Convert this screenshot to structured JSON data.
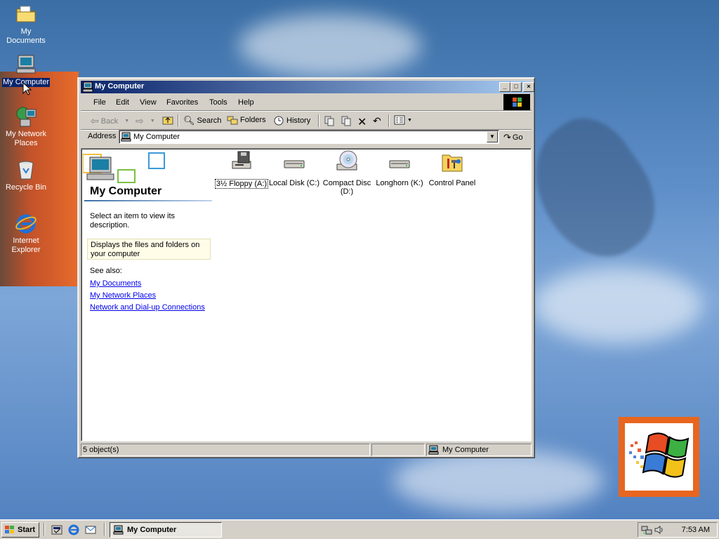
{
  "desktop": {
    "icons": [
      {
        "label": "My Documents"
      },
      {
        "label": "My Computer"
      },
      {
        "label": "My Network Places"
      },
      {
        "label": "Recycle Bin"
      },
      {
        "label": "Internet Explorer"
      }
    ]
  },
  "window": {
    "title": "My Computer",
    "buttons": {
      "minimize": "_",
      "maximize": "□",
      "close": "×"
    },
    "menu": [
      "File",
      "Edit",
      "View",
      "Favorites",
      "Tools",
      "Help"
    ],
    "toolbar": {
      "back": "Back",
      "search": "Search",
      "folders": "Folders",
      "history": "History"
    },
    "address": {
      "label": "Address",
      "value": "My Computer",
      "go": "Go"
    },
    "left_pane": {
      "title": "My Computer",
      "select_text": "Select an item to view its description.",
      "info_box": "Displays the files and folders on your computer",
      "see_also": "See also:",
      "links": [
        "My Documents",
        "My Network Places",
        "Network and Dial-up Connections"
      ]
    },
    "items": [
      {
        "label": "3½ Floppy (A:)",
        "icon": "floppy-drive-icon",
        "selected": true
      },
      {
        "label": "Local Disk (C:)",
        "icon": "hard-disk-icon"
      },
      {
        "label": "Compact Disc (D:)",
        "icon": "cd-drive-icon"
      },
      {
        "label": "Longhorn (K:)",
        "icon": "hard-disk-icon"
      },
      {
        "label": "Control Panel",
        "icon": "control-panel-icon"
      }
    ],
    "status": {
      "count": "5 object(s)",
      "location": "My Computer"
    }
  },
  "taskbar": {
    "start": "Start",
    "task": "My Computer",
    "clock": "7:53 AM"
  },
  "colors": {
    "titlebar_start": "#0a246a",
    "titlebar_end": "#a6caf0",
    "chrome": "#d4d0c8",
    "desktop": "#3a6ea5"
  }
}
